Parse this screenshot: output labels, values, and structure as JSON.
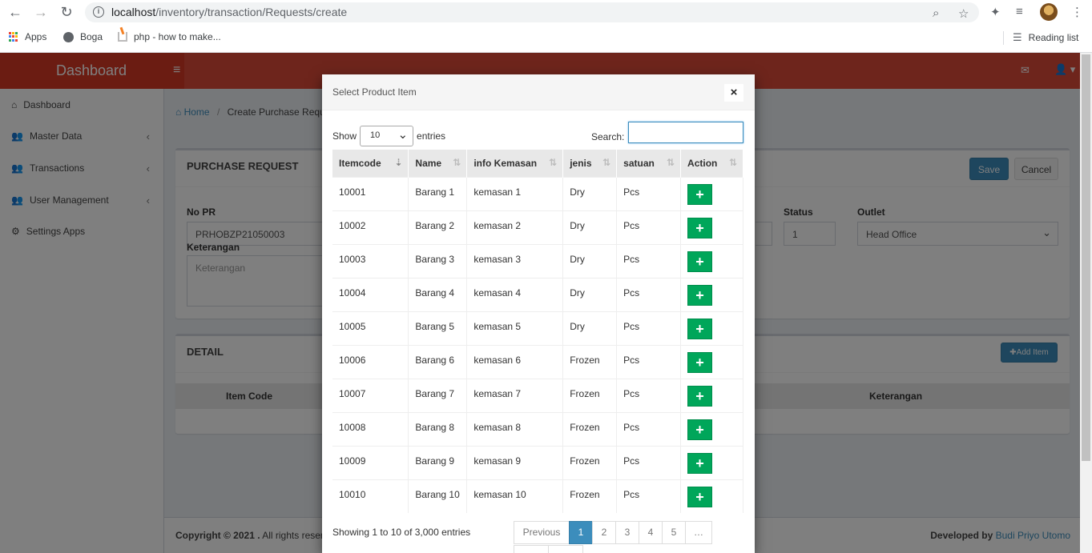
{
  "browser": {
    "url_host": "localhost",
    "url_path": "/inventory/transaction/Requests/create",
    "bookmarks": [
      "Apps",
      "Boga",
      "php - how to make..."
    ],
    "reading_list": "Reading list"
  },
  "app": {
    "brand": "Dashboard",
    "sidebar": [
      {
        "label": "Dashboard",
        "icon": "dashboard-icon"
      },
      {
        "label": "Master Data",
        "icon": "users-icon"
      },
      {
        "label": "Transactions",
        "icon": "users-icon"
      },
      {
        "label": "User Management",
        "icon": "users-icon"
      },
      {
        "label": "Settings Apps",
        "icon": "gears-icon"
      }
    ],
    "breadcrumb": {
      "home": "Home",
      "current": "Create Purchase Reque"
    },
    "form": {
      "title": "PURCHASE REQUEST",
      "save": "Save",
      "cancel": "Cancel",
      "no_pr_label": "No PR",
      "no_pr_value": "PRHOBZP21050003",
      "keterangan_label": "Keterangan",
      "keterangan_placeholder": "Keterangan",
      "status_label": "Status",
      "status_value": "1",
      "outlet_label": "Outlet",
      "outlet_value": "Head Office"
    },
    "detail": {
      "title": "DETAIL",
      "add_item": "Add Item",
      "col_item_code": "Item Code",
      "col_keterangan": "Keterangan"
    },
    "footer": {
      "copyright": "Copyright © 2021 .",
      "rights": "All rights reserv",
      "developed_by": "Developed by",
      "author": "Budi Priyo Utomo"
    }
  },
  "modal": {
    "title": "Select Product Item",
    "close": "×",
    "show_label": "Show",
    "entries_value": "10",
    "entries_label": "entries",
    "search_label": "Search:",
    "columns": [
      "Itemcode",
      "Name",
      "info Kemasan",
      "jenis",
      "satuan",
      "Action"
    ],
    "rows": [
      [
        "10001",
        "Barang 1",
        "kemasan 1",
        "Dry",
        "Pcs"
      ],
      [
        "10002",
        "Barang 2",
        "kemasan 2",
        "Dry",
        "Pcs"
      ],
      [
        "10003",
        "Barang 3",
        "kemasan 3",
        "Dry",
        "Pcs"
      ],
      [
        "10004",
        "Barang 4",
        "kemasan 4",
        "Dry",
        "Pcs"
      ],
      [
        "10005",
        "Barang 5",
        "kemasan 5",
        "Dry",
        "Pcs"
      ],
      [
        "10006",
        "Barang 6",
        "kemasan 6",
        "Frozen",
        "Pcs"
      ],
      [
        "10007",
        "Barang 7",
        "kemasan 7",
        "Frozen",
        "Pcs"
      ],
      [
        "10008",
        "Barang 8",
        "kemasan 8",
        "Frozen",
        "Pcs"
      ],
      [
        "10009",
        "Barang 9",
        "kemasan 9",
        "Frozen",
        "Pcs"
      ],
      [
        "10010",
        "Barang 10",
        "kemasan 10",
        "Frozen",
        "Pcs"
      ]
    ],
    "action_symbol": "+",
    "info": "Showing 1 to 10 of 3,000 entries",
    "pager": [
      "Previous",
      "1",
      "2",
      "3",
      "4",
      "5",
      "…"
    ]
  },
  "colors": {
    "header_red": "#dd4b39",
    "primary": "#3c8dbc",
    "success": "#00a65a"
  }
}
